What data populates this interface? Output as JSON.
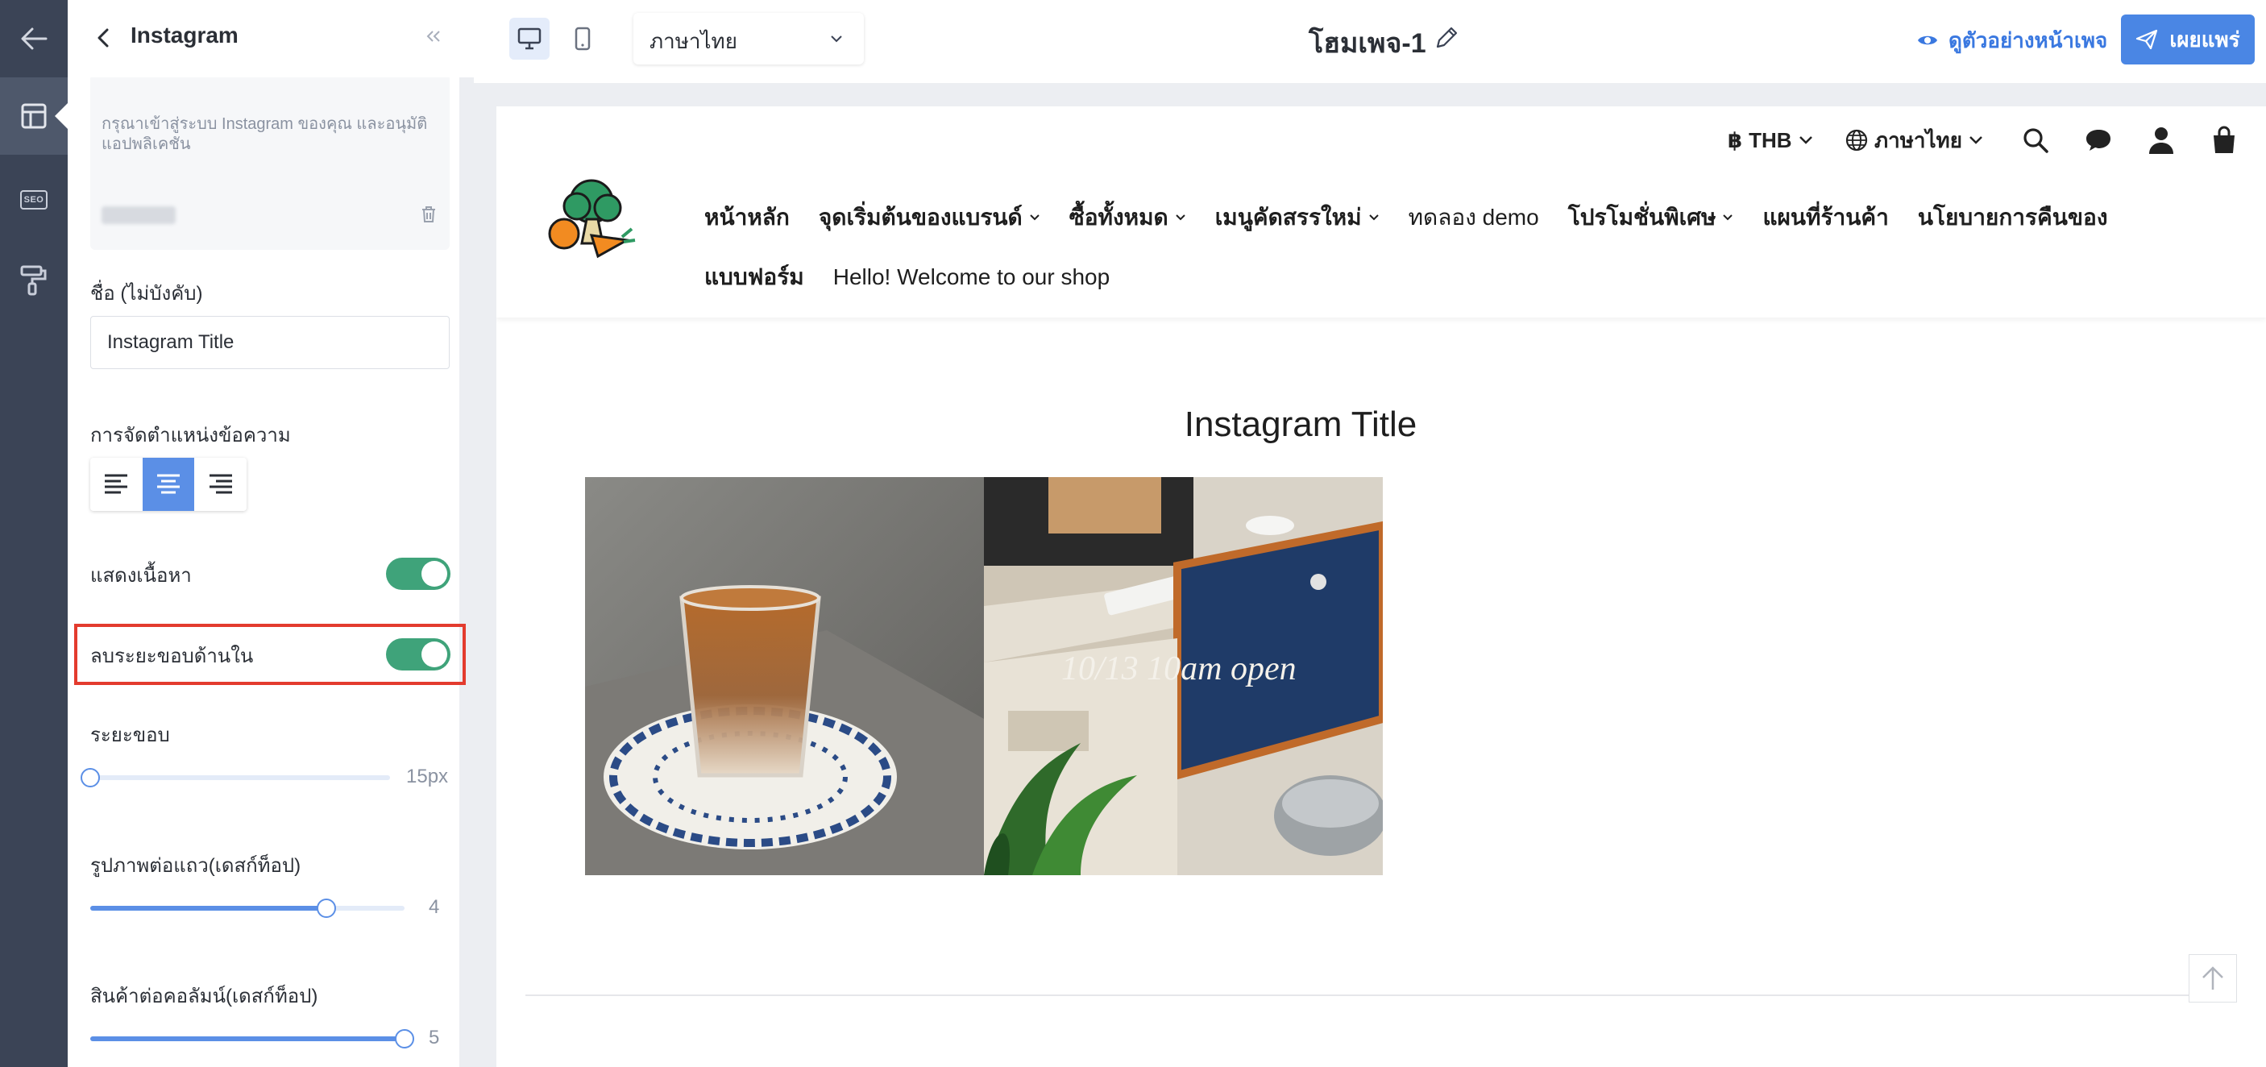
{
  "rail": {
    "back_icon": "arrow-left-icon",
    "layout_icon": "layout-icon",
    "seo_label": "SEO",
    "theme_icon": "paint-roller-icon"
  },
  "panel": {
    "title": "Instagram",
    "login_hint": "กรุณาเข้าสู่ระบบ Instagram ของคุณ และอนุมัติแอปพลิเคชัน",
    "name_label": "ชื่อ (ไม่บังคับ)",
    "name_value": "Instagram Title",
    "alignment_label": "การจัดตำแหน่งข้อความ",
    "alignment_selected": "center",
    "show_content_label": "แสดงเนื้อหา",
    "show_content_on": true,
    "remove_padding_label": "ลบระยะขอบด้านใน",
    "remove_padding_on": true,
    "spacing_label": "ระยะขอบ",
    "spacing_value": "15px",
    "spacing_fraction": 0.0,
    "images_per_row_label": "รูปภาพต่อแถว(เดสก์ท็อป)",
    "images_per_row_value": "4",
    "images_per_row_fraction": 0.75,
    "products_per_col_label": "สินค้าต่อคอลัมน์(เดสก์ท็อป)",
    "products_per_col_value": "5",
    "products_per_col_fraction": 1.0
  },
  "topbar": {
    "language": "ภาษาไทย",
    "page_title": "โฮมเพจ-1",
    "preview_label": "ดูตัวอย่างหน้าเพจ",
    "publish_label": "เผยแพร่"
  },
  "site": {
    "currency": "THB",
    "language": "ภาษาไทย",
    "nav_row1": [
      "หน้าหลัก",
      "จุดเริ่มต้นของแบรนด์",
      "ซื้อทั้งหมด",
      "เมนูคัดสรรใหม่",
      "ทดลอง demo",
      "โปรโมชั่นพิเศษ",
      "แผนที่ร้านค้า",
      "นโยบายการคืนของ"
    ],
    "nav_row2": [
      "แบบฟอร์ม",
      "Hello! Welcome to our shop"
    ],
    "instagram_title": "Instagram Title",
    "photo_caption": "10/13 10am open"
  },
  "colors": {
    "accent": "#4a86e4",
    "toggle_on": "#3fa37a",
    "highlight": "#e33b2e",
    "rail": "#3b4456"
  }
}
